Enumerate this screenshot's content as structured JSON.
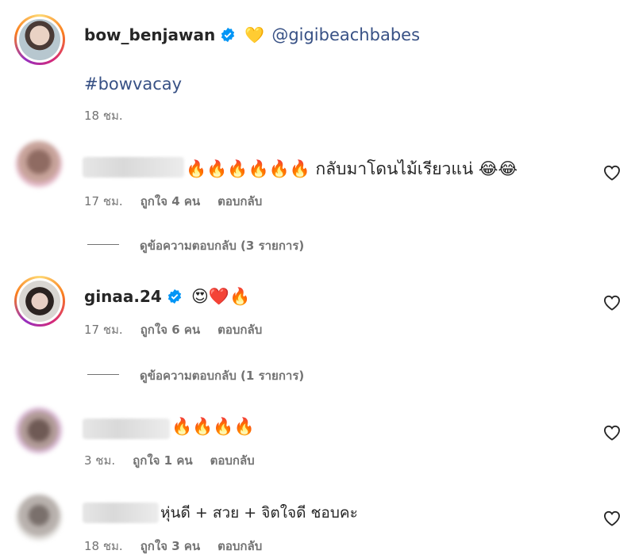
{
  "caption": {
    "username": "bow_benjawan",
    "heart_emoji": "💛",
    "mention": "@gigibeachbabes",
    "hashtag": "#bowvacay",
    "time": "18 ชม."
  },
  "comments": [
    {
      "username": "",
      "text": "🔥🔥🔥🔥🔥🔥 กลับมาโดนไม้เรียวแน่ 😂😂",
      "time": "17 ชม.",
      "likes": "ถูกใจ 4 คน",
      "reply": "ตอบกลับ",
      "view_replies": "ดูข้อความตอบกลับ (3 รายการ)"
    },
    {
      "username": "ginaa.24",
      "text": "😍❤️🔥",
      "time": "17 ชม.",
      "likes": "ถูกใจ 6 คน",
      "reply": "ตอบกลับ",
      "view_replies": "ดูข้อความตอบกลับ (1 รายการ)"
    },
    {
      "username": "",
      "text": "🔥🔥🔥🔥",
      "time": "3 ชม.",
      "likes": "ถูกใจ 1 คน",
      "reply": "ตอบกลับ"
    },
    {
      "username": "",
      "text": "หุ่นดี + สวย + จิตใจดี ชอบคะ",
      "time": "18 ชม.",
      "likes": "ถูกใจ 3 คน",
      "reply": "ตอบกลับ"
    }
  ],
  "icons": {
    "heart": "heart-outline-icon",
    "verified": "verified-badge-icon"
  },
  "colors": {
    "link": "#385185",
    "verified": "#0095f6",
    "meta": "#737373"
  }
}
